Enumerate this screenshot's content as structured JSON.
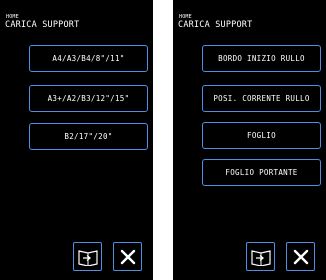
{
  "panels": [
    {
      "breadcrumb": "HOME",
      "title": "CARICA SUPPORT",
      "buttons": [
        "A4/A3/B4/8\"/11\"",
        "A3+/A2/B3/12\"/15\"",
        "B2/17\"/20\""
      ],
      "icons": {
        "manual": "book-arrow-icon",
        "close": "close-x-icon"
      }
    },
    {
      "breadcrumb": "HOME",
      "title": "CARICA SUPPORT",
      "buttons": [
        "BORDO INIZIO RULLO",
        "POSI. CORRENTE RULLO",
        "FOGLIO",
        "FOGLIO PORTANTE"
      ],
      "icons": {
        "manual": "book-arrow-icon",
        "close": "close-x-icon"
      }
    }
  ],
  "colors": {
    "screen_bg": "#000000",
    "button_border": "#4d8fe2",
    "text": "#ffffff"
  }
}
